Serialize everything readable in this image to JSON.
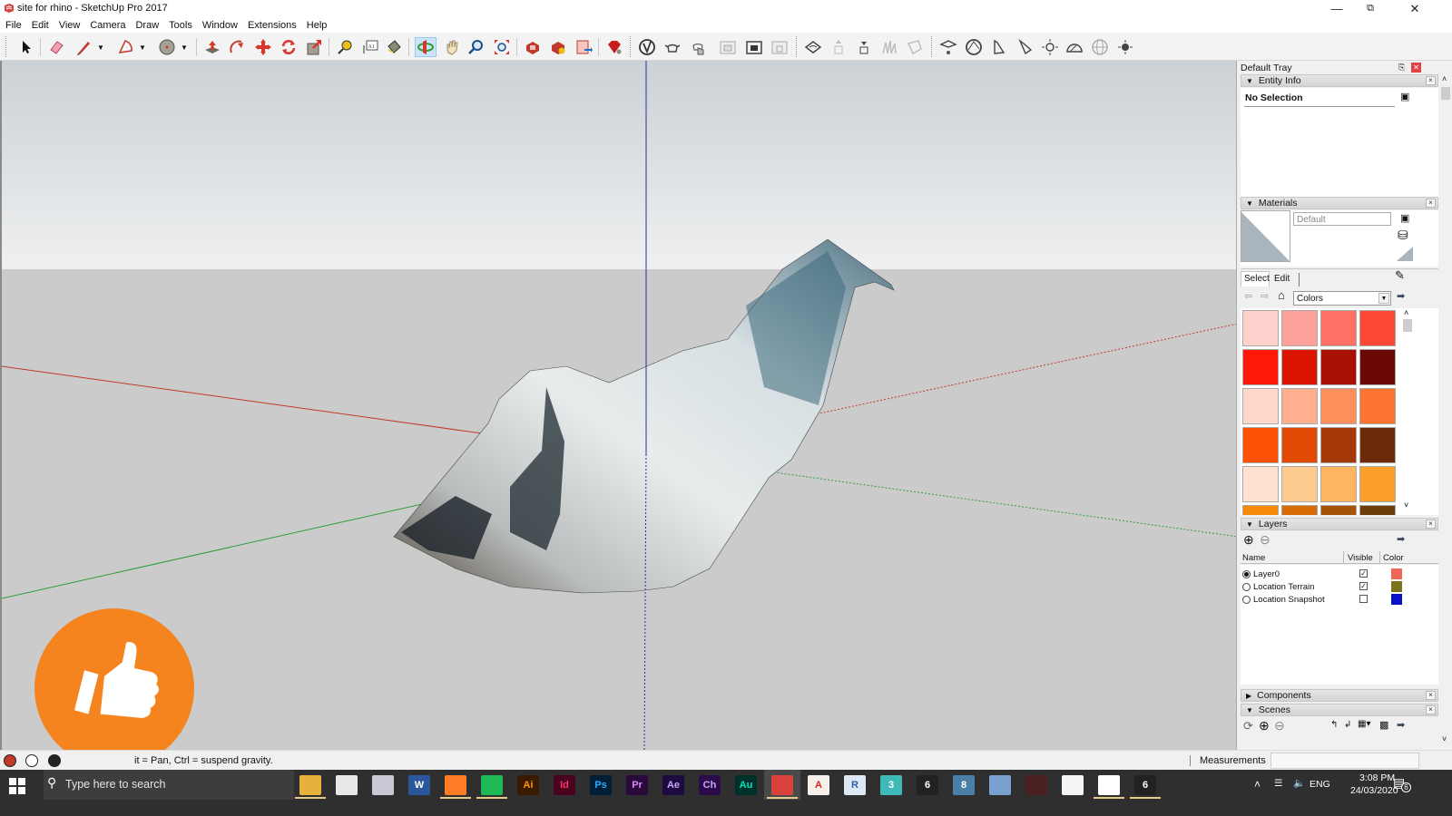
{
  "window": {
    "title": "site for rhino - SketchUp Pro 2017",
    "controls": [
      "minimize",
      "restore",
      "close"
    ]
  },
  "menu": [
    "File",
    "Edit",
    "View",
    "Camera",
    "Draw",
    "Tools",
    "Window",
    "Extensions",
    "Help"
  ],
  "toolbar": {
    "tools": [
      "select-tool",
      "eraser-tool",
      "line-tool",
      "arc-tool",
      "shapes-tool",
      "push-pull-tool",
      "follow-me-tool",
      "move-tool",
      "rotate-tool",
      "scale-tool",
      "tape-measure-tool",
      "text-tool",
      "paint-bucket-tool",
      "orbit-tool",
      "pan-tool",
      "zoom-tool",
      "zoom-extents-tool",
      "3d-warehouse",
      "extension-warehouse",
      "send-to-layout",
      "extension-manager",
      "sandbox-smoove",
      "teapot-component",
      "section-hand",
      "section-plane-display-1",
      "section-plane-display-2",
      "section-plane-display-3",
      "sandbox-from-contours",
      "sandbox-stamp",
      "sandbox-drape",
      "sandbox-add-detail",
      "sandbox-flip-edge",
      "vray-1",
      "vray-2",
      "vray-light-1",
      "vray-light-2",
      "vray-sun",
      "vray-dome",
      "vray-sphere",
      "vray-settings"
    ],
    "active_tool": "orbit-tool"
  },
  "viewport": {
    "axes": {
      "red": "#c0392b",
      "green": "#2e9e3a",
      "blue": "#2a2f9e"
    },
    "model": "textured terrain mesh"
  },
  "overlay": {
    "badge_icon": "thumbs-up-icon",
    "badge_color": "#f5841f"
  },
  "statusbar": {
    "hint": "Drag to orbit. Shift = Pan, Ctrl = suspend gravity.",
    "visible_hint": "it = Pan, Ctrl = suspend gravity.",
    "measurements_label": "Measurements",
    "measurements_value": ""
  },
  "tray": {
    "title": "Default Tray",
    "entity_info": {
      "title": "Entity Info",
      "selection": "No Selection"
    },
    "materials": {
      "title": "Materials",
      "name_value": "Default",
      "tabs": [
        "Select",
        "Edit"
      ],
      "library": "Colors",
      "swatches": [
        [
          "#fdd0cb",
          "#fda19a",
          "#fd7166",
          "#fd4834"
        ],
        [
          "#fd1808",
          "#dd1404",
          "#a80f03",
          "#6a0903"
        ],
        [
          "#fed9c9",
          "#fdaf8f",
          "#fd8f5c",
          "#fd7330"
        ],
        [
          "#fd5203",
          "#e04a05",
          "#a53807",
          "#6c2a08"
        ],
        [
          "#fee4d0",
          "#fdca90",
          "#fdb55f",
          "#fd9d2a"
        ],
        [
          "#f68a0b",
          "#d86d07",
          "#a55407",
          "#6d3c0b"
        ]
      ]
    },
    "layers": {
      "title": "Layers",
      "columns": [
        "Name",
        "Visible",
        "Color"
      ],
      "rows": [
        {
          "name": "Layer0",
          "active": true,
          "visible": true,
          "color": "#f0675a"
        },
        {
          "name": "Location Terrain",
          "active": false,
          "visible": true,
          "color": "#7c7219"
        },
        {
          "name": "Location Snapshot",
          "active": false,
          "visible": false,
          "color": "#0b11c8"
        }
      ]
    },
    "components": {
      "title": "Components"
    },
    "scenes": {
      "title": "Scenes"
    }
  },
  "taskbar": {
    "search_placeholder": "Type here to search",
    "apps": [
      {
        "name": "file-explorer",
        "label": "",
        "bg": "#e8b13d",
        "fg": "#fff",
        "running": true
      },
      {
        "name": "calculator",
        "label": "",
        "bg": "#e8e8e8",
        "fg": "#333",
        "running": false
      },
      {
        "name": "snipping-tool",
        "label": "",
        "bg": "#c9c9d6",
        "fg": "#c33",
        "running": false
      },
      {
        "name": "word",
        "label": "W",
        "bg": "#2b579a",
        "fg": "#fff",
        "running": false
      },
      {
        "name": "firefox",
        "label": "",
        "bg": "#ff7b24",
        "fg": "#fff",
        "running": true
      },
      {
        "name": "spotify",
        "label": "",
        "bg": "#1db954",
        "fg": "#111",
        "running": true
      },
      {
        "name": "illustrator",
        "label": "Ai",
        "bg": "#3a1a00",
        "fg": "#ff9a00",
        "running": false
      },
      {
        "name": "indesign",
        "label": "Id",
        "bg": "#49021f",
        "fg": "#ff3366",
        "running": false
      },
      {
        "name": "photoshop",
        "label": "Ps",
        "bg": "#001e36",
        "fg": "#31a8ff",
        "running": false
      },
      {
        "name": "premiere",
        "label": "Pr",
        "bg": "#2a0a3a",
        "fg": "#d88aff",
        "running": false
      },
      {
        "name": "after-effects",
        "label": "Ae",
        "bg": "#1c0a40",
        "fg": "#c8a5ff",
        "running": false
      },
      {
        "name": "character-animator",
        "label": "Ch",
        "bg": "#2c0b4a",
        "fg": "#c9a5ff",
        "running": false
      },
      {
        "name": "audition",
        "label": "Au",
        "bg": "#00302a",
        "fg": "#00e4bb",
        "running": false
      },
      {
        "name": "sketchup",
        "label": "",
        "bg": "#d9423a",
        "fg": "#fff",
        "running": true,
        "active": true
      },
      {
        "name": "autocad",
        "label": "A",
        "bg": "#f5f0ea",
        "fg": "#d3281c",
        "running": false
      },
      {
        "name": "revit",
        "label": "R",
        "bg": "#dde8f5",
        "fg": "#2c5fa8",
        "running": false
      },
      {
        "name": "3ds-max",
        "label": "3",
        "bg": "#3fb8b8",
        "fg": "#fff",
        "running": false
      },
      {
        "name": "rhino-6",
        "label": "6",
        "bg": "#222",
        "fg": "#fff",
        "running": false
      },
      {
        "name": "lumion",
        "label": "8",
        "bg": "#4a7fa8",
        "fg": "#fff",
        "running": false
      },
      {
        "name": "control-panel",
        "label": "",
        "bg": "#7aa0d0",
        "fg": "#fff",
        "running": false
      },
      {
        "name": "app-red-ring",
        "label": "",
        "bg": "#4a2020",
        "fg": "#c33",
        "running": false
      },
      {
        "name": "blank-document",
        "label": "",
        "bg": "#f5f5f5",
        "fg": "#333",
        "running": false
      },
      {
        "name": "screen-recorder",
        "label": "",
        "bg": "#fff",
        "fg": "#e42",
        "running": true
      },
      {
        "name": "rhino-6-running",
        "label": "6",
        "bg": "#222",
        "fg": "#fff",
        "running": true
      }
    ],
    "system_tray": {
      "language": "ENG",
      "time": "3:08 PM",
      "date": "24/03/2020",
      "notifications": "6"
    }
  }
}
